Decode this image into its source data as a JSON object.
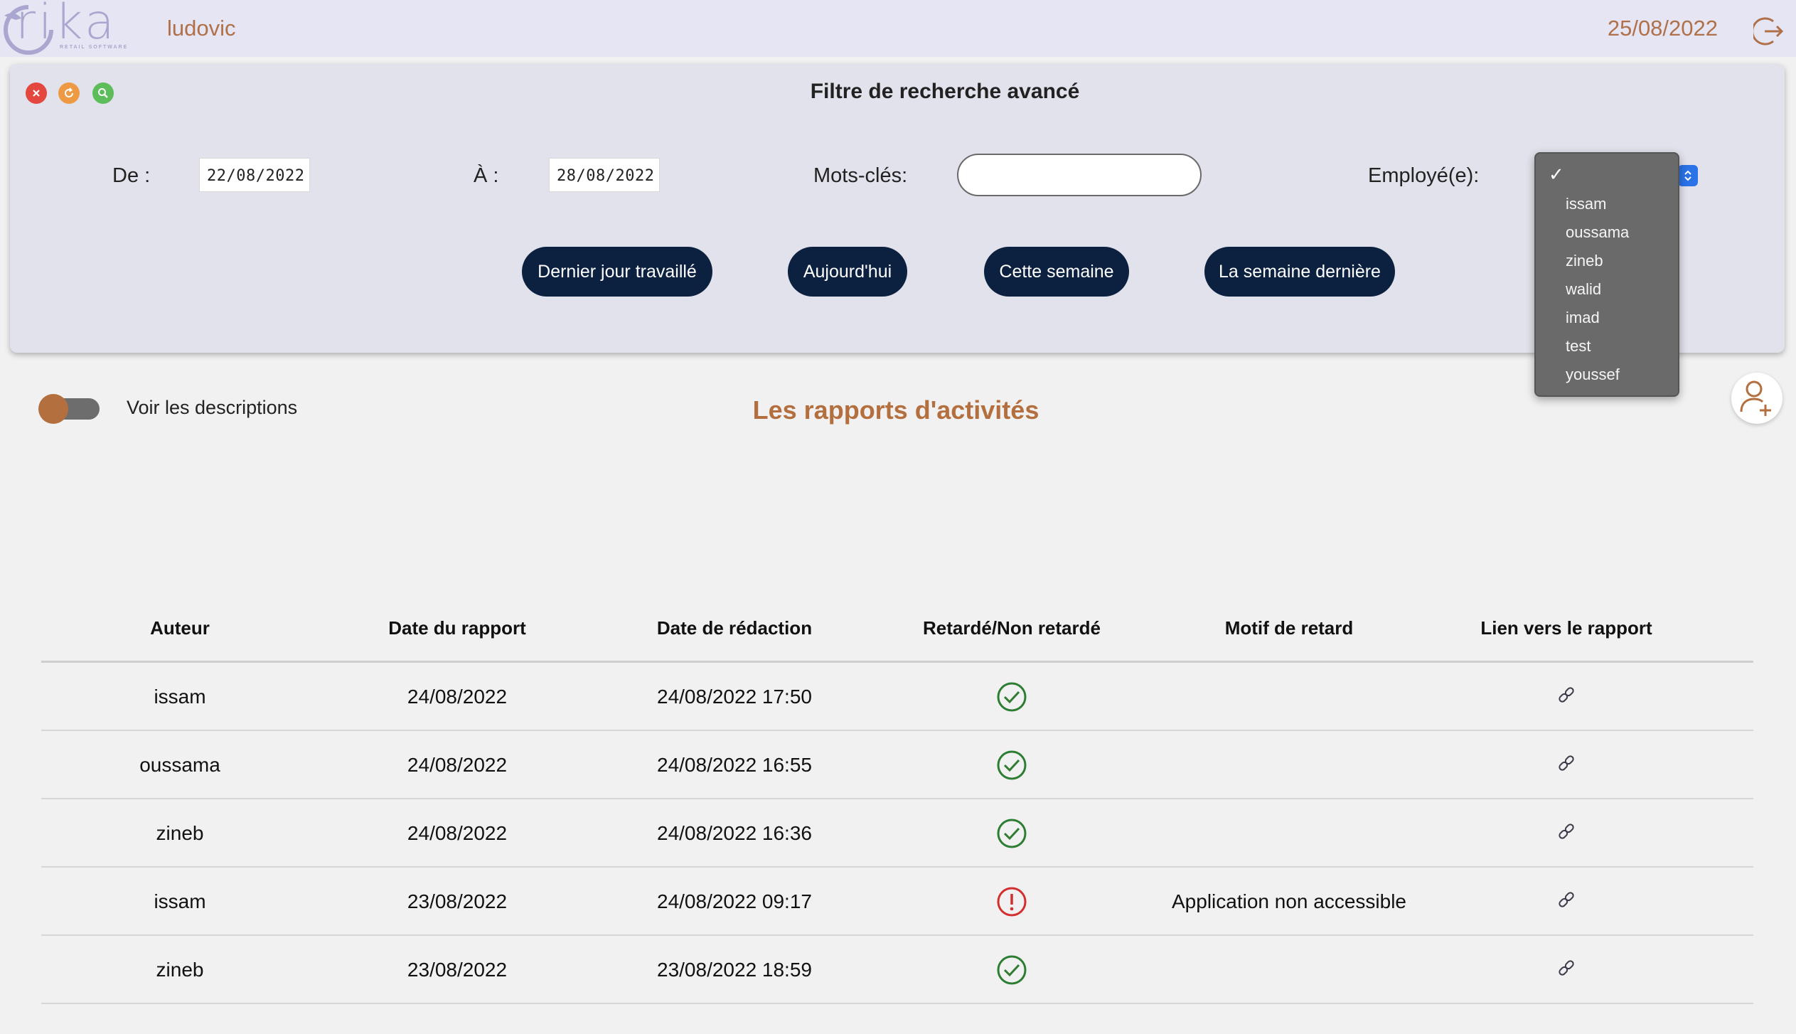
{
  "header": {
    "logo_text": "rika",
    "logo_subtitle": "RETAIL SOFTWARE",
    "username": "ludovic",
    "date": "25/08/2022"
  },
  "filter": {
    "title": "Filtre de recherche avancé",
    "from_label": "De :",
    "from_value": "22/08/2022",
    "to_label": "À :",
    "to_value": "28/08/2022",
    "keywords_label": "Mots-clés:",
    "keywords_value": "",
    "employee_label": "Employé(e):",
    "employee_selected": "",
    "quick_buttons": [
      "Dernier jour travaillé",
      "Aujourd'hui",
      "Cette semaine",
      "La semaine dernière"
    ]
  },
  "employee_options": [
    "issam",
    "oussama",
    "zineb",
    "walid",
    "imad",
    "test",
    "youssef"
  ],
  "content": {
    "toggle_label": "Voir les descriptions",
    "title": "Les rapports d'activités"
  },
  "table": {
    "columns": [
      "Auteur",
      "Date du rapport",
      "Date de rédaction",
      "Retardé/Non retardé",
      "Motif de retard",
      "Lien vers le rapport"
    ],
    "rows": [
      {
        "author": "issam",
        "report_date": "24/08/2022",
        "written_at": "24/08/2022 17:50",
        "status": "on-time",
        "reason": ""
      },
      {
        "author": "oussama",
        "report_date": "24/08/2022",
        "written_at": "24/08/2022 16:55",
        "status": "on-time",
        "reason": ""
      },
      {
        "author": "zineb",
        "report_date": "24/08/2022",
        "written_at": "24/08/2022 16:36",
        "status": "on-time",
        "reason": ""
      },
      {
        "author": "issam",
        "report_date": "23/08/2022",
        "written_at": "24/08/2022 09:17",
        "status": "late",
        "reason": "Application non accessible"
      },
      {
        "author": "zineb",
        "report_date": "23/08/2022",
        "written_at": "23/08/2022 18:59",
        "status": "on-time",
        "reason": ""
      }
    ]
  },
  "colors": {
    "accent": "#b36f3d",
    "button_dark": "#0c2140",
    "ok_green": "#2e7d32",
    "late_red": "#d32f2f"
  },
  "icons": {
    "close": "close-icon",
    "refresh": "refresh-icon",
    "search": "search-icon",
    "logout": "logout-icon",
    "add_user": "add-user-icon",
    "on_time": "check-circle-icon",
    "late": "alert-circle-icon",
    "link": "link-icon"
  }
}
